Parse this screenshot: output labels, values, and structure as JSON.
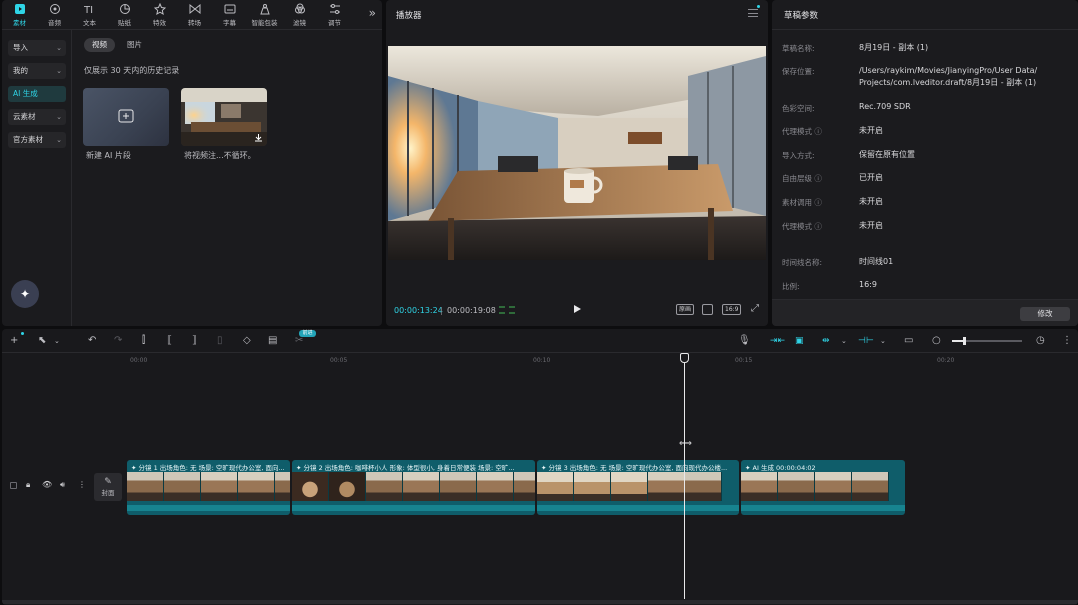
{
  "media": {
    "toolbar": [
      {
        "label": "素材",
        "icon": "media-icon",
        "active": true
      },
      {
        "label": "音频",
        "icon": "audio-icon"
      },
      {
        "label": "文本",
        "icon": "text-icon"
      },
      {
        "label": "贴纸",
        "icon": "sticker-icon"
      },
      {
        "label": "特效",
        "icon": "effects-icon"
      },
      {
        "label": "转场",
        "icon": "transition-icon"
      },
      {
        "label": "字幕",
        "icon": "subtitle-icon"
      },
      {
        "label": "智能包装",
        "icon": "smart-pack-icon"
      },
      {
        "label": "滤镜",
        "icon": "filter-icon"
      },
      {
        "label": "调节",
        "icon": "adjust-icon"
      }
    ],
    "more": "»",
    "nav": [
      {
        "label": "导入",
        "dropdown": true
      },
      {
        "label": "我的",
        "dropdown": true
      },
      {
        "label": "AI 生成",
        "selected": true
      },
      {
        "label": "云素材",
        "dropdown": true
      },
      {
        "label": "官方素材",
        "dropdown": true
      }
    ],
    "tabs": [
      "视频",
      "图片"
    ],
    "history_note": "仅展示 30 天内的历史记录",
    "cards": [
      {
        "caption": "新建 AI 片段"
      },
      {
        "caption": "将视频注...不循环。"
      }
    ]
  },
  "player": {
    "title": "播放器",
    "time_current": "00:00:13:24",
    "time_sep": "|",
    "time_total": "00:00:19:08",
    "btn_original": "原画",
    "btn_ratio": "16:9"
  },
  "params": {
    "title": "草稿参数",
    "rows": [
      {
        "label": "草稿名称:",
        "value": "8月19日 - 副本 (1)"
      },
      {
        "label": "保存位置:",
        "value": "/Users/raykim/Movies/JianyingPro/User Data/\nProjects/com.lveditor.draft/8月19日 - 副本 (1)"
      },
      {
        "label": "色彩空间:",
        "value": "Rec.709 SDR"
      },
      {
        "label": "代理模式 ⓘ",
        "value": "未开启"
      },
      {
        "label": "导入方式:",
        "value": "保留在原有位置"
      },
      {
        "label": "自由层级 ⓘ",
        "value": "已开启"
      },
      {
        "label": "素材调用 ⓘ",
        "value": "未开启"
      },
      {
        "label": "代理模式 ⓘ",
        "value": "未开启"
      },
      {
        "label": "时间线名称:",
        "value": "时间线01"
      },
      {
        "label": "比例:",
        "value": "16:9"
      }
    ],
    "modify_label": "修改"
  },
  "timeline": {
    "badge": "前进",
    "ruler": [
      "00:00",
      "00:05",
      "00:10",
      "00:15",
      "00:20"
    ],
    "cover_label": "封面",
    "clips": [
      {
        "caption": "✦ 分镜 1 出场角色: 无 场景: 空旷现代办公室, 面向..."
      },
      {
        "caption": "✦ 分镜 2 出场角色: 咖啡杯小人 形象: 体型很小, 身着日常便装 场景: 空旷..."
      },
      {
        "caption": "✦ 分镜 3 出场角色: 无 场景: 空旷现代办公室, 面向现代办公楼..."
      },
      {
        "caption": "✦ AI 生成  00:00:04:02"
      }
    ]
  },
  "colors": {
    "accent": "#2fd4e6",
    "clip": "#0f5d6a",
    "panel": "#1b1b1e"
  }
}
